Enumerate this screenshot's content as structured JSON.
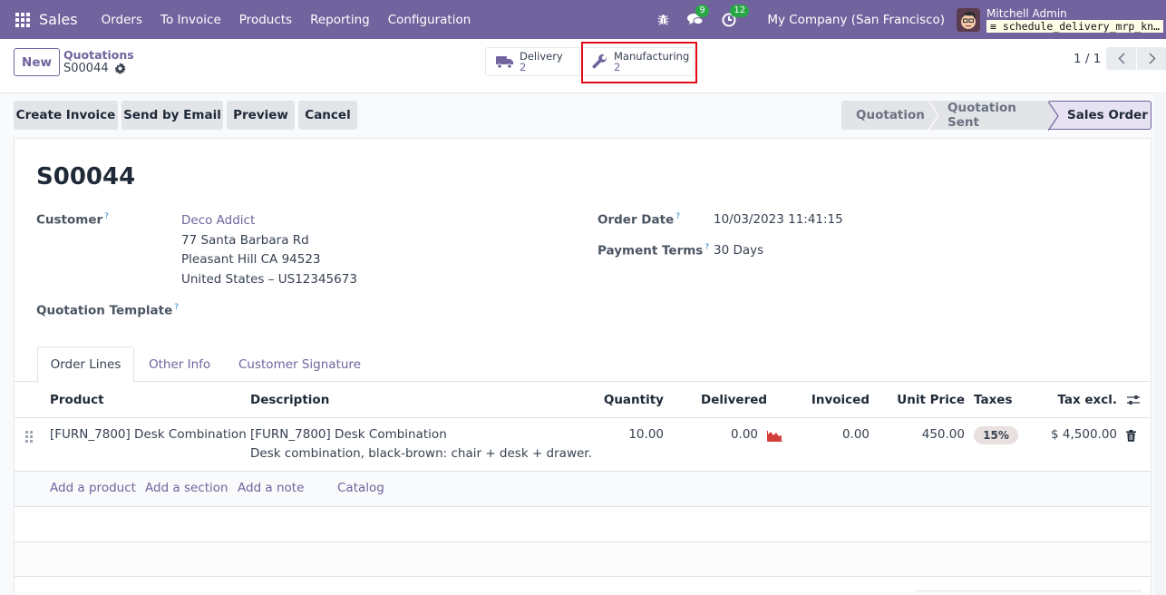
{
  "navbar": {
    "app_name": "Sales",
    "menu": [
      "Orders",
      "To Invoice",
      "Products",
      "Reporting",
      "Configuration"
    ],
    "icons": {
      "apps": "apps-grid-icon",
      "debug": "bug-icon",
      "messages": "chat-icon",
      "activities": "clock-icon"
    },
    "messages_count": "9",
    "activities_count": "12",
    "company": "My Company (San Francisco)",
    "user_name": "Mitchell Admin",
    "database": "schedule_delivery_mrp_kn…"
  },
  "control_panel": {
    "new_label": "New",
    "breadcrumb_parent": "Quotations",
    "record_name": "S00044",
    "smart_buttons": [
      {
        "label": "Delivery",
        "value": "2",
        "icon": "truck-icon"
      },
      {
        "label": "Manufacturing",
        "value": "2",
        "icon": "wrench-icon"
      }
    ],
    "pager": "1 / 1"
  },
  "actions": [
    "Create Invoice",
    "Send by Email",
    "Preview",
    "Cancel"
  ],
  "statusbar": {
    "stages": [
      "Quotation",
      "Quotation Sent",
      "Sales Order"
    ],
    "current": "Sales Order"
  },
  "form": {
    "title": "S00044",
    "customer_label": "Customer",
    "customer_name": "Deco Addict",
    "customer_address": [
      "77 Santa Barbara Rd",
      "Pleasant Hill CA 94523",
      "United States – US12345673"
    ],
    "template_label": "Quotation Template",
    "order_date_label": "Order Date",
    "order_date": "10/03/2023 11:41:15",
    "payment_terms_label": "Payment Terms",
    "payment_terms": "30 Days",
    "help_mark": "?"
  },
  "tabs": [
    "Order Lines",
    "Other Info",
    "Customer Signature"
  ],
  "order_lines": {
    "columns": [
      "Product",
      "Description",
      "Quantity",
      "Delivered",
      "Invoiced",
      "Unit Price",
      "Taxes",
      "Tax excl."
    ],
    "rows": [
      {
        "product": "[FURN_7800] Desk Combination",
        "description_line1": "[FURN_7800] Desk Combination",
        "description_line2": "Desk combination, black-brown: chair + desk + drawer.",
        "quantity": "10.00",
        "delivered": "0.00",
        "invoiced": "0.00",
        "unit_price": "450.00",
        "taxes": "15%",
        "subtotal": "$ 4,500.00"
      }
    ],
    "add_links": [
      "Add a product",
      "Add a section",
      "Add a note",
      "Catalog"
    ]
  }
}
